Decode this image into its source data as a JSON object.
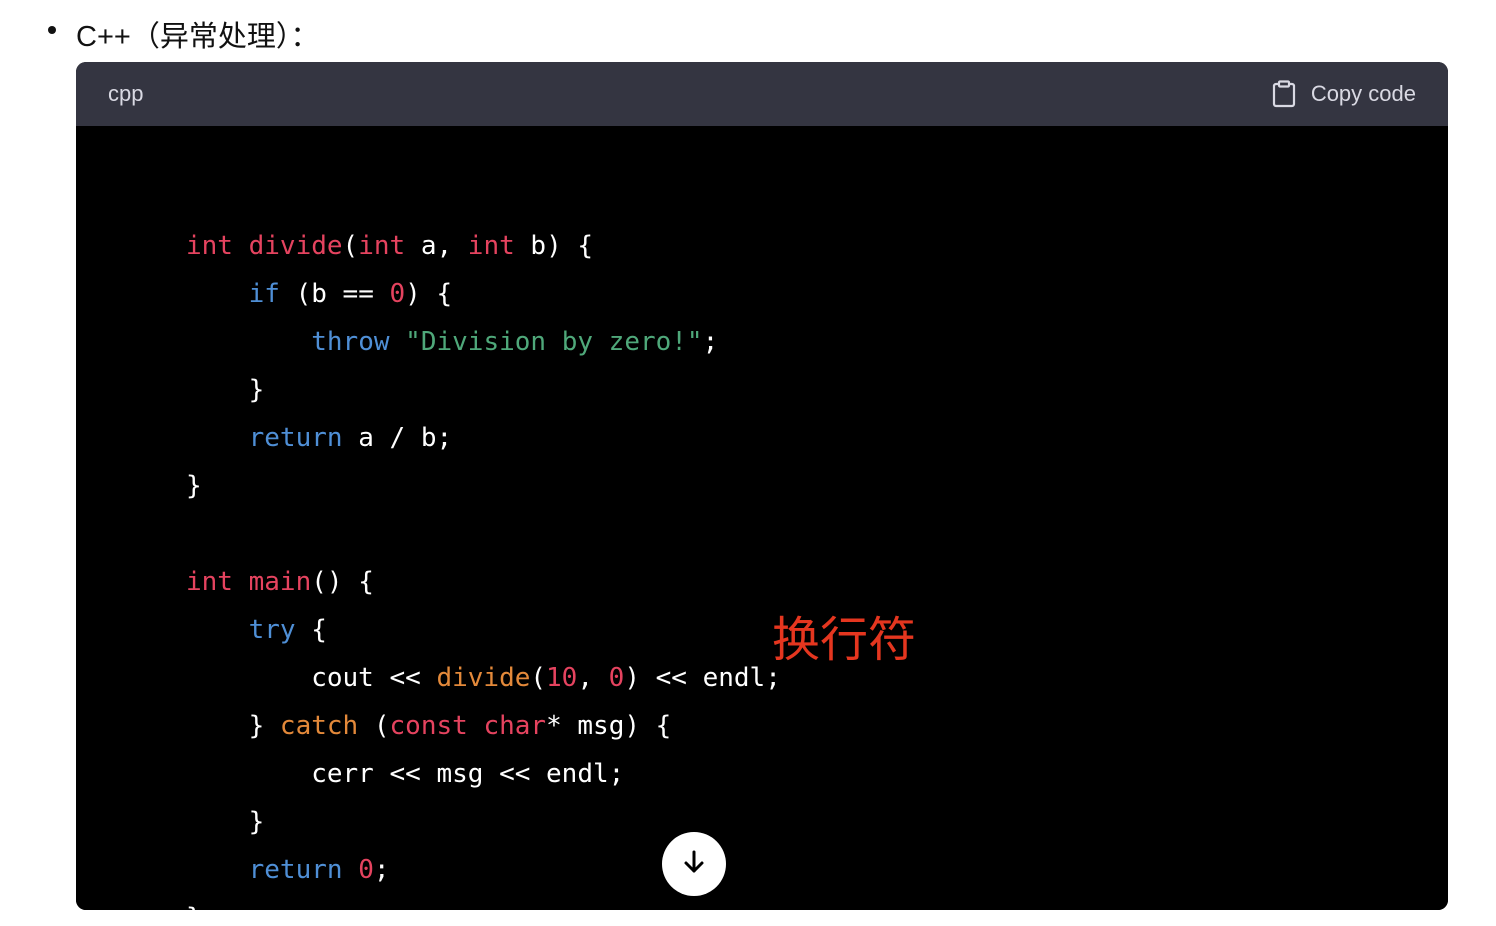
{
  "bullet": {
    "text": "C++（异常处理）："
  },
  "code_block": {
    "language": "cpp",
    "copy_label": "Copy code",
    "lines": [
      "int divide(int a, int b) {",
      "    if (b == 0) {",
      "        throw \"Division by zero!\";",
      "    }",
      "    return a / b;",
      "}",
      "",
      "int main() {",
      "    try {",
      "        cout << divide(10, 0) << endl;",
      "    } catch (const char* msg) {",
      "        cerr << msg << endl;",
      "    }",
      "    return 0;",
      "}"
    ]
  },
  "annotation": {
    "text": "换行符",
    "color": "#e5361f"
  },
  "icons": {
    "copy": "clipboard-icon",
    "scroll": "arrow-down-icon"
  }
}
